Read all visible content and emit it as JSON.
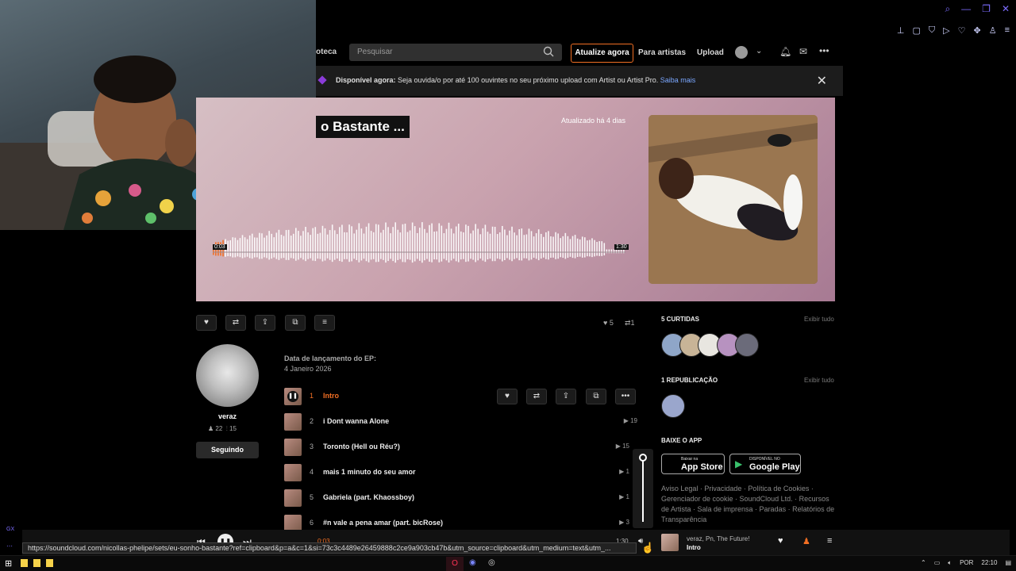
{
  "header": {
    "library_partial": "oteca",
    "search_placeholder": "Pesquisar",
    "upgrade_label": "Atualize agora",
    "for_artists": "Para artistas",
    "upload": "Upload"
  },
  "banner": {
    "bold": "Disponível agora:",
    "text": " Seja ouvida/o por até 100 ouvintes no seu próximo upload com Artist ou Artist Pro.",
    "more": "Saiba mais"
  },
  "hero": {
    "title_partial": "o Bastante ...",
    "updated": "Atualizado há 4 dias",
    "time_start": "0:03",
    "time_end": "1:30"
  },
  "stats": {
    "likes": "5",
    "reposts": "1"
  },
  "artist": {
    "name": "veraz",
    "followers": "22",
    "tracks": "15",
    "follow_label": "Seguindo"
  },
  "release": {
    "label": "Data de lançamento do EP:",
    "date": "4 Janeiro 2026"
  },
  "tracks": [
    {
      "num": "1",
      "title": "Intro",
      "plays": ""
    },
    {
      "num": "2",
      "title": "i Dont wanna Alone",
      "plays": "19"
    },
    {
      "num": "3",
      "title": "Toronto (Hell ou Réu?)",
      "plays": "15"
    },
    {
      "num": "4",
      "title": "mais 1 minuto do seu amor",
      "plays": "1"
    },
    {
      "num": "5",
      "title": "Gabriela (part. Khaossboy)",
      "plays": "1"
    },
    {
      "num": "6",
      "title": "#n vale a pena amar (part. bicRose)",
      "plays": "3"
    }
  ],
  "sidebar": {
    "likes_heading": "5 CURTIDAS",
    "show_all": "Exibir tudo",
    "reposts_heading": "1 REPUBLICAÇÃO",
    "app_heading": "BAIXE O APP",
    "appstore_small": "Baixar na",
    "appstore": "App Store",
    "gplay_small": "DISPONÍVEL NO",
    "gplay": "Google Play",
    "footer": "Aviso Legal · Privacidade · Política de Cookies · Gerenciador de cookie · SoundCloud Ltd. · Recursos de Artista · Sala de imprensa · Paradas · Relatórios de Transparência"
  },
  "player": {
    "elapsed": "0:03",
    "total": "1:30",
    "artist": "veraz, Pn, The Future!",
    "title": "Intro"
  },
  "status_url": "https://soundcloud.com/nicollas-phelipe/sets/eu-sonho-bastante?ref=clipboard&p=a&c=1&si=73c3c4489e26459888c2ce9a903cb47b&utm_source=clipboard&utm_medium=text&utm_...",
  "taskbar": {
    "lang": "POR",
    "time": "22:10"
  },
  "colors": {
    "accent": "#f26f23",
    "link": "#7aa7ff"
  }
}
